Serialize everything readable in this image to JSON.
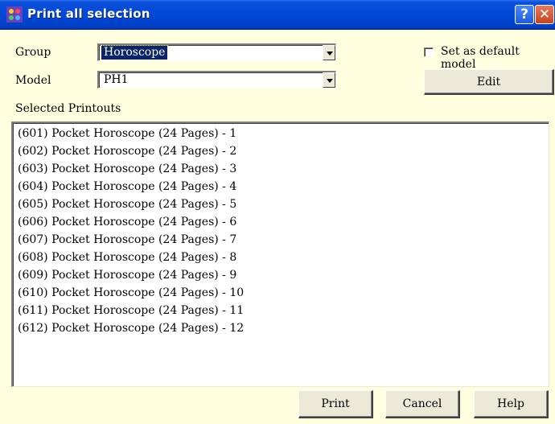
{
  "window": {
    "title": "Print all selection"
  },
  "group": {
    "label": "Group",
    "value": "Horoscope"
  },
  "model": {
    "label": "Model",
    "value": "PH1"
  },
  "default_model": {
    "label": "Set as default model",
    "checked": false
  },
  "edit_button": "Edit",
  "printouts": {
    "label": "Selected Printouts",
    "items": [
      "(601) Pocket Horoscope (24 Pages) - 1",
      "(602) Pocket Horoscope (24 Pages) - 2",
      "(603) Pocket Horoscope (24 Pages) - 3",
      "(604) Pocket Horoscope (24 Pages) - 4",
      "(605) Pocket Horoscope (24 Pages) - 5",
      "(606) Pocket Horoscope (24 Pages) - 6",
      "(607) Pocket Horoscope (24 Pages) - 7",
      "(608) Pocket Horoscope (24 Pages) - 8",
      "(609) Pocket Horoscope (24 Pages) - 9",
      "(610) Pocket Horoscope (24 Pages) - 10",
      "(611) Pocket Horoscope (24 Pages) - 11",
      "(612) Pocket Horoscope (24 Pages) - 12"
    ]
  },
  "buttons": {
    "print": "Print",
    "cancel": "Cancel",
    "help": "Help"
  },
  "titlebar_buttons": {
    "help": "?",
    "close": "✕"
  },
  "colors": {
    "dialog_background": "#ffffe0",
    "titlebar": "#0049d6",
    "selection": "#0a246a"
  }
}
